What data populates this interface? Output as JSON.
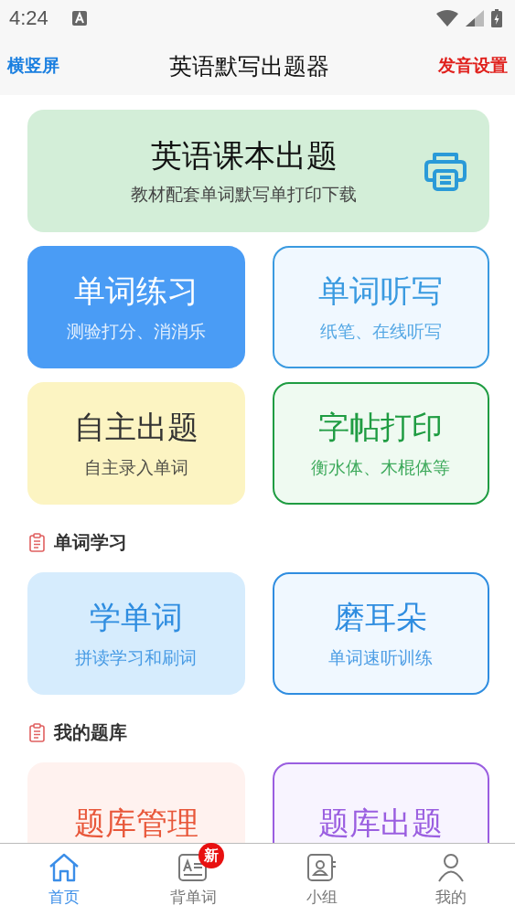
{
  "status_bar": {
    "time": "4:24"
  },
  "header": {
    "left": "横竖屏",
    "title": "英语默写出题器",
    "right": "发音设置"
  },
  "banner": {
    "title": "英语课本出题",
    "subtitle": "教材配套单词默写单打印下载"
  },
  "cards": [
    {
      "title": "单词练习",
      "subtitle": "测验打分、消消乐"
    },
    {
      "title": "单词听写",
      "subtitle": "纸笔、在线听写"
    },
    {
      "title": "自主出题",
      "subtitle": "自主录入单词"
    },
    {
      "title": "字帖打印",
      "subtitle": "衡水体、木棍体等"
    }
  ],
  "sections": [
    {
      "title": "单词学习",
      "cards": [
        {
          "title": "学单词",
          "subtitle": "拼读学习和刷词"
        },
        {
          "title": "磨耳朵",
          "subtitle": "单词速听训练"
        }
      ]
    },
    {
      "title": "我的题库",
      "cards": [
        {
          "title": "题库管理"
        },
        {
          "title": "题库出题"
        }
      ]
    }
  ],
  "tabs": [
    {
      "label": "首页",
      "selected": true
    },
    {
      "label": "背单词",
      "selected": false,
      "badge": "新"
    },
    {
      "label": "小组",
      "selected": false
    },
    {
      "label": "我的",
      "selected": false
    }
  ]
}
